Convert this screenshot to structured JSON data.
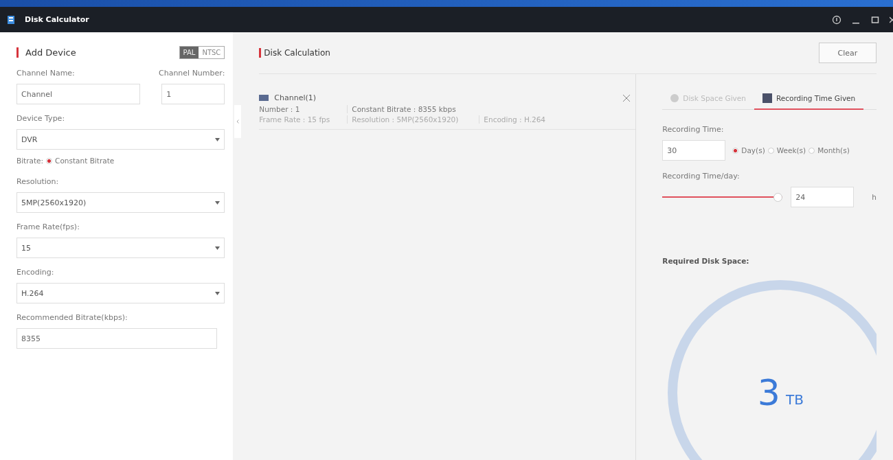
{
  "window": {
    "title": "Disk Calculator"
  },
  "add_device": {
    "title": "Add Device",
    "standards": [
      {
        "label": "PAL",
        "selected": true
      },
      {
        "label": "NTSC",
        "selected": false
      }
    ],
    "channel_name": {
      "label": "Channel Name:",
      "value": "Channel"
    },
    "channel_number": {
      "label": "Channel Number:",
      "value": "1"
    },
    "selects": [
      {
        "label": "Device Type:",
        "value": "DVR"
      }
    ],
    "bitrate": {
      "label": "Bitrate:",
      "option": "Constant Bitrate",
      "selected": true
    },
    "selects2": [
      {
        "label": "Resolution:",
        "value": "5MP(2560x1920)"
      },
      {
        "label": "Frame Rate(fps):",
        "value": "15"
      },
      {
        "label": "Encoding:",
        "value": "H.264"
      }
    ],
    "recommended": {
      "label": "Recommended Bitrate(kbps):",
      "value": "8355"
    }
  },
  "disk_calculation": {
    "title": "Disk Calculation",
    "clear": "Clear",
    "channels": [
      {
        "name": "Channel(1)",
        "number": "Number : 1",
        "bitrate": "Constant Bitrate : 8355 kbps",
        "frame_rate": "Frame Rate : 15 fps",
        "resolution": "Resolution : 5MP(2560x1920)",
        "encoding": "Encoding : H.264"
      }
    ]
  },
  "calc_tabs": [
    {
      "label": "Disk Space Given",
      "selected": false
    },
    {
      "label": "Recording Time Given",
      "selected": true
    }
  ],
  "recording_time": {
    "label": "Recording Time:",
    "value": "30",
    "units": [
      {
        "label": "Day(s)",
        "selected": true
      },
      {
        "label": "Week(s)",
        "selected": false
      },
      {
        "label": "Month(s)",
        "selected": false
      }
    ]
  },
  "per_day": {
    "label": "Recording Time/day:",
    "level": 1,
    "value": "24",
    "unit": "h"
  },
  "result": {
    "label": "Required Disk Space:",
    "value": "3",
    "unit": "TB"
  }
}
